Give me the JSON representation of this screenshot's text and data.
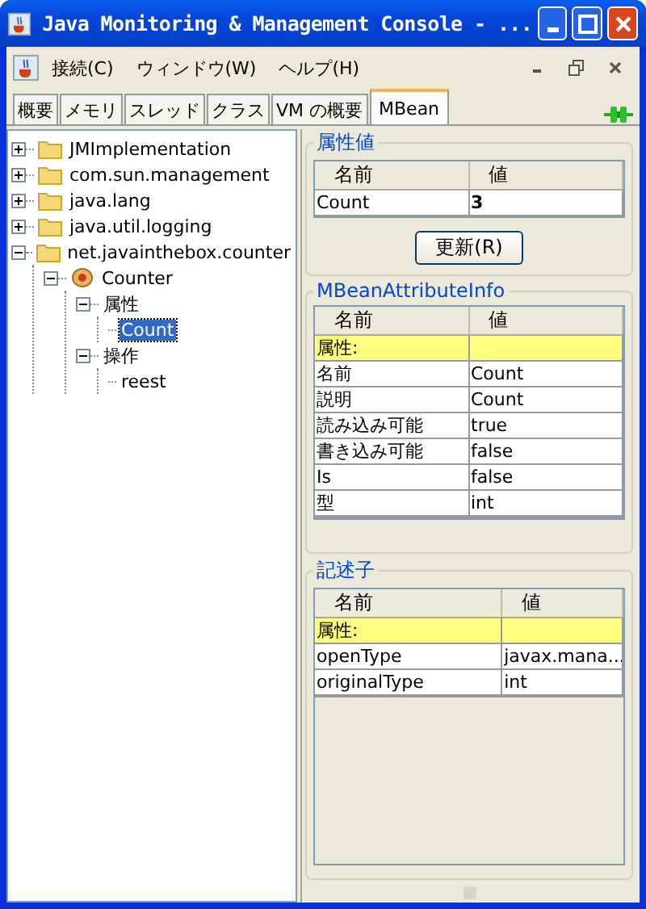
{
  "window": {
    "title": "Java Monitoring & Management Console - ..."
  },
  "menu": [
    {
      "label": "接続(C)"
    },
    {
      "label": "ウィンドウ(W)"
    },
    {
      "label": "ヘルプ(H)"
    }
  ],
  "tabs": [
    {
      "label": "概要",
      "selected": false
    },
    {
      "label": "メモリ",
      "selected": false
    },
    {
      "label": "スレッド",
      "selected": false
    },
    {
      "label": "クラス",
      "selected": false
    },
    {
      "label": "VM の概要",
      "selected": false
    },
    {
      "label": "MBean",
      "selected": true
    }
  ],
  "tree": [
    {
      "label": "JMImplementation",
      "kind": "folder",
      "expanded": false,
      "selected": false
    },
    {
      "label": "com.sun.management",
      "kind": "folder",
      "expanded": false,
      "selected": false
    },
    {
      "label": "java.lang",
      "kind": "folder",
      "expanded": false,
      "selected": false
    },
    {
      "label": "java.util.logging",
      "kind": "folder",
      "expanded": false,
      "selected": false
    },
    {
      "label": "net.javainthebox.counter",
      "kind": "folder",
      "expanded": true,
      "selected": false,
      "children": [
        {
          "label": "Counter",
          "kind": "bean",
          "expanded": true,
          "selected": false,
          "children": [
            {
              "label": "属性",
              "expanded": true,
              "selected": false,
              "children": [
                {
                  "label": "Count",
                  "selected": true
                }
              ]
            },
            {
              "label": "操作",
              "expanded": true,
              "selected": false,
              "children": [
                {
                  "label": "reest",
                  "selected": false
                }
              ]
            }
          ]
        }
      ]
    }
  ],
  "attribute_values": {
    "title": "属性値",
    "columns": [
      "名前",
      "値"
    ],
    "rows": [
      [
        "Count",
        "3"
      ]
    ],
    "button": "更新(R)"
  },
  "attribute_info": {
    "title": "MBeanAttributeInfo",
    "columns": [
      "名前",
      "値"
    ],
    "rows": [
      {
        "kind": "section",
        "cells": [
          "属性:",
          ""
        ]
      },
      {
        "kind": "row",
        "cells": [
          "名前",
          "Count"
        ]
      },
      {
        "kind": "row",
        "cells": [
          "説明",
          "Count"
        ]
      },
      {
        "kind": "row",
        "cells": [
          "読み込み可能",
          "true"
        ]
      },
      {
        "kind": "row",
        "cells": [
          "書き込み可能",
          "false"
        ]
      },
      {
        "kind": "row",
        "cells": [
          "Is",
          "false"
        ]
      },
      {
        "kind": "row",
        "cells": [
          "型",
          "int"
        ]
      }
    ]
  },
  "descriptor": {
    "title": "記述子",
    "columns": [
      "名前",
      "値"
    ],
    "rows": [
      {
        "kind": "section",
        "cells": [
          "属性:",
          ""
        ]
      },
      {
        "kind": "row",
        "cells": [
          "openType",
          "javax.mana..."
        ]
      },
      {
        "kind": "row",
        "cells": [
          "originalType",
          "int"
        ]
      }
    ]
  }
}
